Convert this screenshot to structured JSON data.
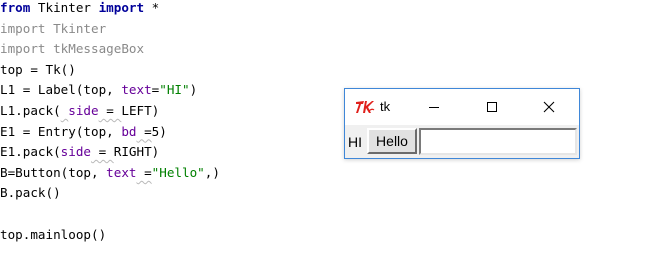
{
  "editor": {
    "lines": [
      [
        {
          "text": "from",
          "cls": "kw"
        },
        {
          "text": " Tkinter ",
          "cls": "plain"
        },
        {
          "text": "import",
          "cls": "kw"
        },
        {
          "text": " *",
          "cls": "plain"
        }
      ],
      [
        {
          "text": "import Tkinter",
          "cls": "dim"
        }
      ],
      [
        {
          "text": "import tkMessageBox",
          "cls": "dim"
        }
      ],
      [
        {
          "text": "top = Tk()",
          "cls": "plain"
        }
      ],
      [
        {
          "text": "L1 = Label(top, ",
          "cls": "plain"
        },
        {
          "text": "text",
          "cls": "kwarg"
        },
        {
          "text": "=",
          "cls": "plain"
        },
        {
          "text": "\"HI\"",
          "cls": "str"
        },
        {
          "text": ")",
          "cls": "plain"
        }
      ],
      [
        {
          "text": "L1.pack(",
          "cls": "plain"
        },
        {
          "text": " ",
          "cls": "plain squig"
        },
        {
          "text": "side",
          "cls": "kwarg"
        },
        {
          "text": " = ",
          "cls": "plain squig"
        },
        {
          "text": "LEFT)",
          "cls": "plain"
        }
      ],
      [
        {
          "text": "E1 = Entry(top, ",
          "cls": "plain"
        },
        {
          "text": "bd",
          "cls": "kwarg"
        },
        {
          "text": " =",
          "cls": "plain squig"
        },
        {
          "text": "5)",
          "cls": "plain"
        }
      ],
      [
        {
          "text": "E1.pack(",
          "cls": "plain"
        },
        {
          "text": "side",
          "cls": "kwarg"
        },
        {
          "text": " = ",
          "cls": "plain squig"
        },
        {
          "text": "RIGHT)",
          "cls": "plain"
        }
      ],
      [
        {
          "text": "B=Button(top, ",
          "cls": "plain"
        },
        {
          "text": "text",
          "cls": "kwarg"
        },
        {
          "text": " =",
          "cls": "plain squig"
        },
        {
          "text": "\"Hello\"",
          "cls": "str"
        },
        {
          "text": ",)",
          "cls": "plain"
        }
      ],
      [
        {
          "text": "B.pack()",
          "cls": "plain"
        }
      ],
      [],
      [
        {
          "text": "top.mainloop()",
          "cls": "plain"
        }
      ]
    ]
  },
  "tk_window": {
    "title": "tk",
    "logo_icon": "tk-feather-icon",
    "controls": {
      "minimize_icon": "minimize-icon",
      "maximize_icon": "maximize-icon",
      "close_icon": "close-icon"
    },
    "label_text": "HI",
    "button_label": "Hello",
    "entry_value": ""
  },
  "colors": {
    "keyword": "#00009a",
    "string": "#008000",
    "kwarg": "#660099",
    "dimmed": "#8a8a8a",
    "window_border": "#3f87d8",
    "tk_logo_red": "#e0201b"
  }
}
